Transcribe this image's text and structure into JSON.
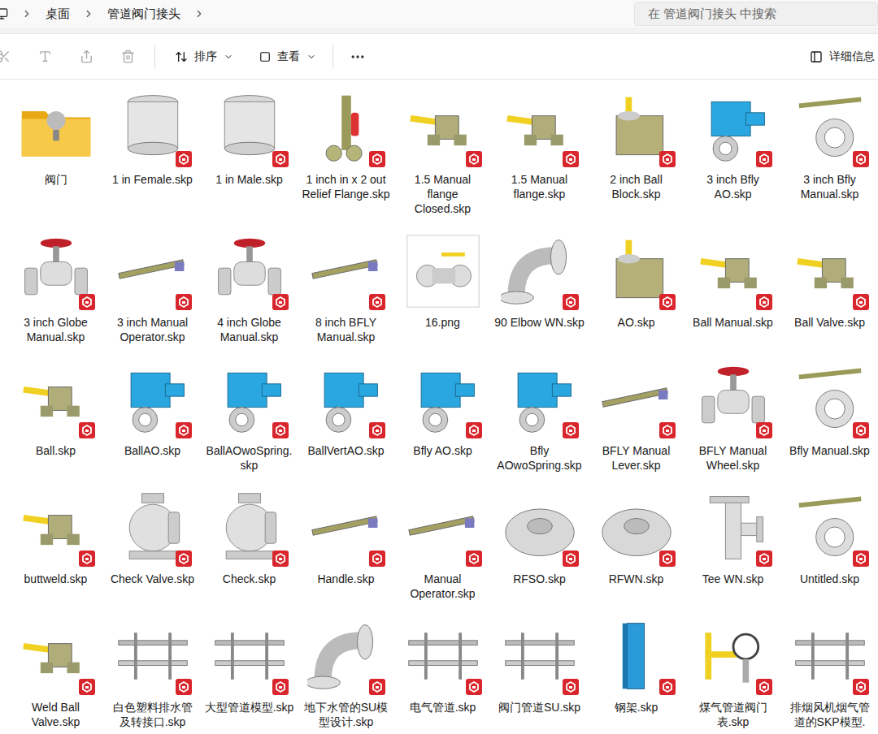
{
  "window": {
    "title": "管道阀门接头"
  },
  "breadcrumb": [
    "桌面",
    "管道阀门接头"
  ],
  "search": {
    "placeholder": "在 管道阀门接头 中搜索"
  },
  "toolbar": {
    "sort": "排序",
    "view": "查看",
    "details": "详细信息"
  },
  "items": [
    {
      "name": "阀门",
      "kind": "folder",
      "selected": false
    },
    {
      "name": "1 in Female.skp",
      "kind": "fitting",
      "selected": false
    },
    {
      "name": "1 in Male.skp",
      "kind": "fitting",
      "selected": false
    },
    {
      "name": "1 inch in x 2 out Relief Flange.skp",
      "kind": "relief",
      "selected": false
    },
    {
      "name": "1.5 Manual flange Closed.skp",
      "kind": "ballvalve",
      "selected": false
    },
    {
      "name": "1.5 Manual flange.skp",
      "kind": "ballvalve",
      "selected": false
    },
    {
      "name": "2 inch Ball Block.skp",
      "kind": "block",
      "selected": false
    },
    {
      "name": "3 inch Bfly AO.skp",
      "kind": "actuator",
      "selected": false
    },
    {
      "name": "3 inch Bfly Manual.skp",
      "kind": "bfly",
      "selected": false
    },
    {
      "name": "3 inch Globe Manual.skp",
      "kind": "globe",
      "selected": false
    },
    {
      "name": "3 inch Manual Operator.skp",
      "kind": "lever",
      "selected": false
    },
    {
      "name": "4 inch Globe Manual.skp",
      "kind": "globe",
      "selected": false
    },
    {
      "name": "8 inch BFLY Manual.skp",
      "kind": "lever",
      "selected": false
    },
    {
      "name": "16.png",
      "kind": "image",
      "selected": false
    },
    {
      "name": "90 Elbow WN.skp",
      "kind": "elbow",
      "selected": false
    },
    {
      "name": "AO.skp",
      "kind": "block",
      "selected": false
    },
    {
      "name": "Ball Manual.skp",
      "kind": "ballvalve",
      "selected": false
    },
    {
      "name": "Ball Valve.skp",
      "kind": "ballvalve",
      "selected": false
    },
    {
      "name": "Ball.skp",
      "kind": "ballvalve",
      "selected": false
    },
    {
      "name": "BallAO.skp",
      "kind": "actuator",
      "selected": false
    },
    {
      "name": "BallAOwoSpring.skp",
      "kind": "actuator",
      "selected": false
    },
    {
      "name": "BallVertAO.skp",
      "kind": "actuator",
      "selected": false
    },
    {
      "name": "Bfly AO.skp",
      "kind": "actuator",
      "selected": false
    },
    {
      "name": "Bfly AOwoSpring.skp",
      "kind": "actuator",
      "selected": false
    },
    {
      "name": "BFLY Manual Lever.skp",
      "kind": "lever",
      "selected": false
    },
    {
      "name": "BFLY Manual Wheel.skp",
      "kind": "globe",
      "selected": false
    },
    {
      "name": "Bfly Manual.skp",
      "kind": "bfly",
      "selected": false
    },
    {
      "name": "buttweld.skp",
      "kind": "ballvalve",
      "selected": false
    },
    {
      "name": "Check Valve.skp",
      "kind": "check",
      "selected": false
    },
    {
      "name": "Check.skp",
      "kind": "check",
      "selected": false
    },
    {
      "name": "Handle.skp",
      "kind": "lever",
      "selected": false
    },
    {
      "name": "Manual Operator.skp",
      "kind": "lever",
      "selected": false
    },
    {
      "name": "RFSO.skp",
      "kind": "flange",
      "selected": false
    },
    {
      "name": "RFWN.skp",
      "kind": "flange",
      "selected": false
    },
    {
      "name": "Tee WN.skp",
      "kind": "tee",
      "selected": false
    },
    {
      "name": "Untitled.skp",
      "kind": "bfly",
      "selected": false
    },
    {
      "name": "Weld Ball Valve.skp",
      "kind": "ballvalve",
      "selected": false
    },
    {
      "name": "白色塑料排水管及转接口.skp",
      "kind": "pipes",
      "selected": false
    },
    {
      "name": "大型管道模型.skp",
      "kind": "pipes",
      "selected": false
    },
    {
      "name": "地下水管的SU模型设计.skp",
      "kind": "elbow",
      "selected": false
    },
    {
      "name": "电气管道.skp",
      "kind": "pipes",
      "selected": false
    },
    {
      "name": "阀门管道SU.skp",
      "kind": "pipes",
      "selected": false
    },
    {
      "name": "钢架.skp",
      "kind": "beam",
      "selected": false
    },
    {
      "name": "煤气管道阀门表.skp",
      "kind": "gauge",
      "selected": false
    },
    {
      "name": "排烟风机烟气管道的SKP模型.",
      "kind": "pipes",
      "selected": false
    }
  ]
}
